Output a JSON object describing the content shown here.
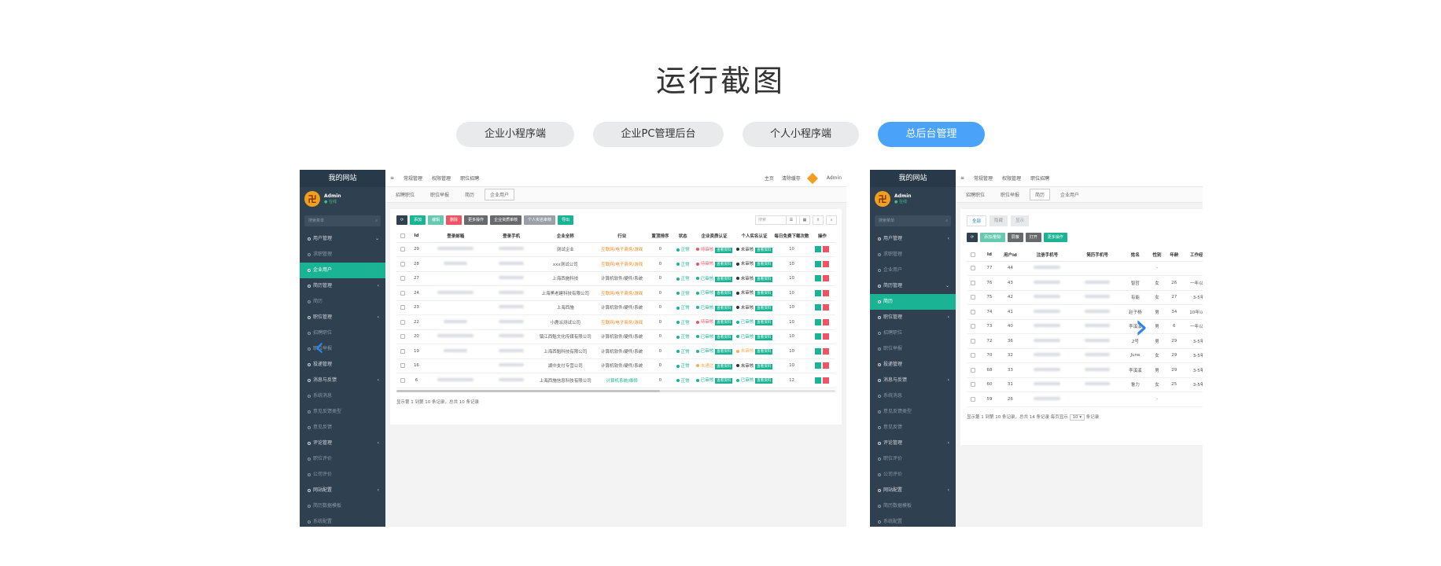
{
  "title": "运行截图",
  "tabs": [
    {
      "label": "企业小程序端"
    },
    {
      "label": "企业PC管理后台"
    },
    {
      "label": "个人小程序端"
    },
    {
      "label": "总后台管理",
      "active": true
    }
  ],
  "colors": {
    "accent": "#4aa3f8",
    "sidebar": "#2f4050",
    "active_green": "#1ab394"
  },
  "left_shot": {
    "brand": "我的网站",
    "user": {
      "name": "Admin",
      "status": "在线"
    },
    "search_placeholder": "搜索菜单",
    "menu": [
      {
        "label": "用户管理",
        "type": "group",
        "arrow": "⌄"
      },
      {
        "label": "求职管理",
        "type": "sub"
      },
      {
        "label": "企业用户",
        "type": "sub",
        "active": true
      },
      {
        "label": "简历管理",
        "type": "group",
        "arrow": "‹"
      },
      {
        "label": "简历",
        "type": "sub"
      },
      {
        "label": "职位管理",
        "type": "group",
        "arrow": "‹"
      },
      {
        "label": "招聘职位",
        "type": "sub"
      },
      {
        "label": "职位举报",
        "type": "sub"
      },
      {
        "label": "投递管理",
        "type": "group"
      },
      {
        "label": "消息与反馈",
        "type": "group",
        "arrow": "‹"
      },
      {
        "label": "系统消息",
        "type": "sub"
      },
      {
        "label": "意见反馈类型",
        "type": "sub"
      },
      {
        "label": "意见反馈",
        "type": "sub"
      },
      {
        "label": "评论管理",
        "type": "group",
        "arrow": "‹"
      },
      {
        "label": "职位评价",
        "type": "sub"
      },
      {
        "label": "公司评价",
        "type": "sub"
      },
      {
        "label": "网站配置",
        "type": "group",
        "arrow": "‹"
      },
      {
        "label": "简历数据模板",
        "type": "sub"
      },
      {
        "label": "系统配置",
        "type": "sub"
      }
    ],
    "topbar": {
      "items": [
        "≡",
        "常规管理",
        "权限管理",
        "职位招聘"
      ],
      "right": [
        "主页",
        "清除缓存",
        "Admin"
      ]
    },
    "page_tabs": [
      {
        "label": "招聘职位"
      },
      {
        "label": "职位举报"
      },
      {
        "label": "简历"
      },
      {
        "label": "企业用户",
        "on": true
      }
    ],
    "toolbar": [
      "添加",
      "编辑",
      "删除",
      "更多操作",
      "企业资质审核",
      "个人实名审核",
      "导出"
    ],
    "search": "搜索",
    "columns": [
      "",
      "Id",
      "登录邮箱",
      "登录手机",
      "企业全称",
      "行业",
      "置顶排序",
      "状态",
      "企业资质认证",
      "个人实名认证",
      "每日免费下载次数",
      "操作"
    ],
    "rows": [
      {
        "id": "29",
        "company": "测试企业",
        "industry": "互联网/电子商务/游戏",
        "ind_color": "orange",
        "sort": "0",
        "status": "正常",
        "qual": "待审核",
        "qual_color": "red",
        "real": "未审核",
        "real_color": "dark",
        "dl": "10"
      },
      {
        "id": "28",
        "company": "xxx测试公司",
        "industry": "互联网/电子商务/游戏",
        "ind_color": "orange",
        "sort": "0",
        "status": "正常",
        "qual": "待审核",
        "qual_color": "red",
        "real": "未审核",
        "real_color": "dark",
        "dl": "10"
      },
      {
        "id": "27",
        "company": "上海西施科技",
        "industry": "计算机软件/硬件/系统",
        "ind_color": "",
        "sort": "0",
        "status": "正常",
        "qual": "已审核",
        "qual_color": "green",
        "real": "未审核",
        "real_color": "dark",
        "dl": "10"
      },
      {
        "id": "24",
        "company": "上海黑老建科技有限公司",
        "industry": "互联网/电子商务/游戏",
        "ind_color": "orange",
        "sort": "0",
        "status": "正常",
        "qual": "已审核",
        "qual_color": "green",
        "real": "未审核",
        "real_color": "dark",
        "dl": "10"
      },
      {
        "id": "23",
        "company": "上海西施",
        "industry": "计算机软件/硬件/系统",
        "ind_color": "",
        "sort": "0",
        "status": "正常",
        "qual": "已审核",
        "qual_color": "green",
        "real": "未审核",
        "real_color": "dark",
        "dl": "10"
      },
      {
        "id": "22",
        "company": "小鹿派测试公司",
        "industry": "互联网/电子商务/游戏",
        "ind_color": "orange",
        "sort": "0",
        "status": "正常",
        "qual": "待审核",
        "qual_color": "red",
        "real": "已审核",
        "real_color": "green",
        "dl": "10"
      },
      {
        "id": "20",
        "company": "镇江西魁文化传媒有限公司",
        "industry": "计算机软件/硬件/系统",
        "ind_color": "",
        "sort": "0",
        "status": "正常",
        "qual": "已审核",
        "qual_color": "green",
        "real": "已审核",
        "real_color": "green",
        "dl": "10"
      },
      {
        "id": "19",
        "company": "上海西魁科技有限公司",
        "industry": "计算机软件/硬件/系统",
        "ind_color": "",
        "sort": "0",
        "status": "正常",
        "qual": "已审核",
        "qual_color": "green",
        "real": "未审核",
        "real_color": "orange",
        "dl": "10"
      },
      {
        "id": "16",
        "company": "湖中支付专营公司",
        "industry": "计算机软件/硬件/系统",
        "ind_color": "",
        "sort": "0",
        "status": "正常",
        "qual": "未通过",
        "qual_color": "orange",
        "real": "未审核",
        "real_color": "dark",
        "dl": "10"
      },
      {
        "id": "6",
        "company": "上海西施信息科技有限公司",
        "industry": "计算机系统/维修",
        "ind_color": "green",
        "sort": "0",
        "status": "正常",
        "qual": "已审核",
        "qual_color": "green",
        "real": "已审核",
        "real_color": "green",
        "dl": "12"
      }
    ],
    "view_label": "查看资料",
    "footer": "显示第 1 到第 10 条记录，总共 10 条记录"
  },
  "right_shot": {
    "brand": "我的网站",
    "user": {
      "name": "Admin",
      "status": "在线"
    },
    "search_placeholder": "搜索菜单",
    "menu": [
      {
        "label": "用户管理",
        "type": "group",
        "arrow": "‹"
      },
      {
        "label": "求职管理",
        "type": "sub"
      },
      {
        "label": "企业用户",
        "type": "sub"
      },
      {
        "label": "简历管理",
        "type": "group",
        "arrow": "⌄"
      },
      {
        "label": "简历",
        "type": "sub",
        "active": true
      },
      {
        "label": "职位管理",
        "type": "group",
        "arrow": "‹"
      },
      {
        "label": "招聘职位",
        "type": "sub"
      },
      {
        "label": "职位举报",
        "type": "sub"
      },
      {
        "label": "投递管理",
        "type": "group"
      },
      {
        "label": "消息与反馈",
        "type": "group",
        "arrow": "‹"
      },
      {
        "label": "系统消息",
        "type": "sub"
      },
      {
        "label": "意见反馈类型",
        "type": "sub"
      },
      {
        "label": "意见反馈",
        "type": "sub"
      },
      {
        "label": "评论管理",
        "type": "group",
        "arrow": "‹"
      },
      {
        "label": "职位评价",
        "type": "sub"
      },
      {
        "label": "公司评价",
        "type": "sub"
      },
      {
        "label": "网站配置",
        "type": "group",
        "arrow": "‹"
      },
      {
        "label": "简历数据模板",
        "type": "sub"
      },
      {
        "label": "系统配置",
        "type": "sub"
      }
    ],
    "topbar": {
      "items": [
        "≡",
        "常规管理",
        "权限管理",
        "职位招聘"
      ]
    },
    "page_tabs": [
      {
        "label": "招聘职位"
      },
      {
        "label": "职位举报"
      },
      {
        "label": "简历",
        "on": true
      },
      {
        "label": "企业用户"
      }
    ],
    "sub_tabs": [
      "全部",
      "隐藏",
      "显示"
    ],
    "toolbar": [
      "添加/删除",
      "屏蔽",
      "打开",
      "更多操作"
    ],
    "columns": [
      "",
      "Id",
      "用户id",
      "注册手机号",
      "简历手机号",
      "姓名",
      "性别",
      "年龄",
      "工作经验",
      "学"
    ],
    "rows": [
      {
        "id": "77",
        "uid": "44",
        "name": "",
        "sex": "",
        "age": "",
        "exp": "",
        "dash": "-"
      },
      {
        "id": "76",
        "uid": "43",
        "name": "智哲",
        "sex": "女",
        "age": "26",
        "exp": "一年以内",
        "dash": ""
      },
      {
        "id": "75",
        "uid": "42",
        "name": "有能",
        "sex": "女",
        "age": "27",
        "exp": "3-5年",
        "dash": ""
      },
      {
        "id": "74",
        "uid": "41",
        "name": "赵子杨",
        "sex": "男",
        "age": "34",
        "exp": "10年以上",
        "dash": ""
      },
      {
        "id": "73",
        "uid": "40",
        "name": "李溪溪",
        "sex": "男",
        "age": "6",
        "exp": "一年以内",
        "dash": ""
      },
      {
        "id": "72",
        "uid": "36",
        "name": "2号",
        "sex": "男",
        "age": "29",
        "exp": "3-5年",
        "dash": ""
      },
      {
        "id": "70",
        "uid": "32",
        "name": "June",
        "sex": "女",
        "age": "29",
        "exp": "3-5年",
        "dash": ""
      },
      {
        "id": "68",
        "uid": "33",
        "name": "李溪溪",
        "sex": "男",
        "age": "29",
        "exp": "3-5年",
        "dash": ""
      },
      {
        "id": "60",
        "uid": "31",
        "name": "鲁力",
        "sex": "女",
        "age": "25",
        "exp": "3-5年",
        "dash": ""
      },
      {
        "id": "59",
        "uid": "26",
        "name": "",
        "sex": "",
        "age": "",
        "exp": "",
        "dash": "-"
      }
    ],
    "footer": "显示第 1 到第 10 条记录，总共 14 条记录 每页显示",
    "page_size": "10",
    "footer_tail": "条记录"
  },
  "nav": {
    "prev": "‹",
    "next": "›"
  }
}
